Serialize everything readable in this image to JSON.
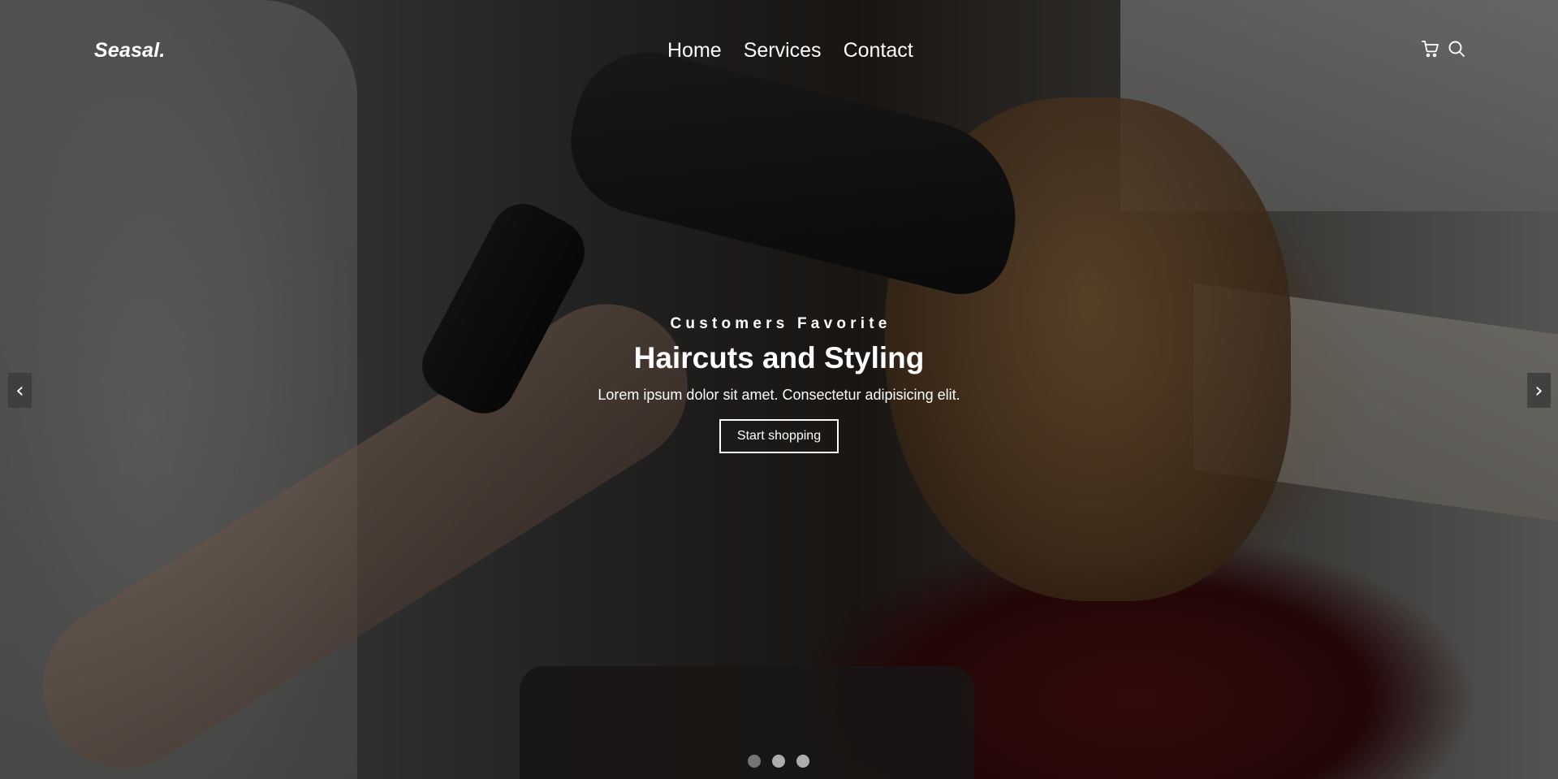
{
  "navbar": {
    "logo": "Seasal.",
    "links": [
      {
        "label": "Home"
      },
      {
        "label": "Services"
      },
      {
        "label": "Contact"
      }
    ],
    "icons": [
      "cart-icon",
      "search-icon"
    ]
  },
  "hero": {
    "eyebrow": "Customers Favorite",
    "headline": "Haircuts and Styling",
    "subtext": "Lorem ipsum dolor sit amet. Consectetur adipisicing elit.",
    "cta_label": "Start shopping"
  },
  "carousel": {
    "prev_label": "‹",
    "next_label": "›",
    "slide_count": 3,
    "active_index": 1
  }
}
